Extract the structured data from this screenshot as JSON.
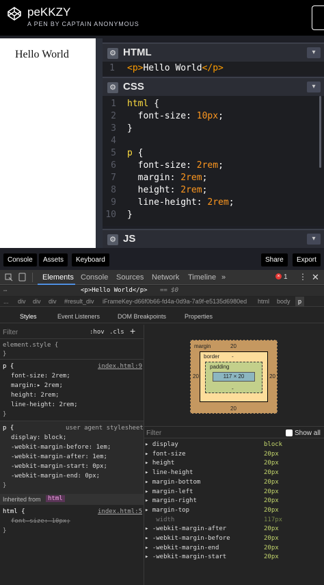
{
  "header": {
    "title": "peKKZY",
    "subtitle": "A PEN BY CAPTAIN ANONYMOUS"
  },
  "preview": {
    "text": "Hello World"
  },
  "html_panel": {
    "title": "HTML",
    "lines": [
      {
        "n": "1",
        "code": "<p>Hello World</p>"
      }
    ]
  },
  "css_panel": {
    "title": "CSS",
    "lines": [
      {
        "n": "1",
        "code": "html {"
      },
      {
        "n": "2",
        "code": "  font-size: 10px;"
      },
      {
        "n": "3",
        "code": "}"
      },
      {
        "n": "4",
        "code": ""
      },
      {
        "n": "5",
        "code": "p {"
      },
      {
        "n": "6",
        "code": "  font-size: 2rem;"
      },
      {
        "n": "7",
        "code": "  margin: 2rem;"
      },
      {
        "n": "8",
        "code": "  height: 2rem;"
      },
      {
        "n": "9",
        "code": "  line-height: 2rem;"
      },
      {
        "n": "10",
        "code": "}"
      }
    ]
  },
  "js_panel": {
    "title": "JS"
  },
  "bottom_bar": {
    "console": "Console",
    "assets": "Assets",
    "keyboard": "Keyboard",
    "share": "Share",
    "export": "Export"
  },
  "devtools": {
    "tabs": [
      "Elements",
      "Console",
      "Sources",
      "Network",
      "Timeline",
      "»"
    ],
    "error_count": "1",
    "selected_node": "<p>Hello World</p>",
    "selected_suffix": "== $0",
    "crumbs": [
      "...",
      "div",
      "div",
      "div",
      "#result_div",
      "iFrameKey-d66f0b66-fd4a-0d9a-7a9f-e5135d6980ed",
      "html",
      "body",
      "p"
    ],
    "subtabs": [
      "Styles",
      "Event Listeners",
      "DOM Breakpoints",
      "Properties"
    ],
    "filter_placeholder": "Filter",
    "hov": ":hov",
    "cls": ".cls",
    "element_style": "element.style {",
    "rule1_selector": "p {",
    "rule1_source": "index.html:9",
    "rule1_props": [
      "font-size: 2rem;",
      "margin:▸ 2rem;",
      "height: 2rem;",
      "line-height: 2rem;"
    ],
    "rule2_selector": "p {",
    "rule2_source": "user agent stylesheet",
    "rule2_props": [
      "display: block;",
      "-webkit-margin-before: 1em;",
      "-webkit-margin-after: 1em;",
      "-webkit-margin-start: 0px;",
      "-webkit-margin-end: 0px;"
    ],
    "inherited_label": "Inherited from",
    "inherited_tag": "html",
    "rule3_selector": "html {",
    "rule3_source": "index.html:5",
    "rule3_prop": "font-size: 10px;",
    "boxmodel": {
      "margin_label": "margin",
      "margin_top": "20",
      "margin_bottom": "20",
      "margin_left": "20",
      "margin_right": "20",
      "border_label": "border",
      "border_val": "-",
      "padding_label": "padding",
      "padding_val": "-",
      "content": "117 × 20",
      "dash": "-"
    },
    "computed_filter": "Filter",
    "show_all": "Show all",
    "computed": [
      {
        "k": "display",
        "v": "block"
      },
      {
        "k": "font-size",
        "v": "20px"
      },
      {
        "k": "height",
        "v": "20px"
      },
      {
        "k": "line-height",
        "v": "20px"
      },
      {
        "k": "margin-bottom",
        "v": "20px"
      },
      {
        "k": "margin-left",
        "v": "20px"
      },
      {
        "k": "margin-right",
        "v": "20px"
      },
      {
        "k": "margin-top",
        "v": "20px"
      },
      {
        "k": "width",
        "v": "117px"
      },
      {
        "k": "-webkit-margin-after",
        "v": "20px"
      },
      {
        "k": "-webkit-margin-before",
        "v": "20px"
      },
      {
        "k": "-webkit-margin-end",
        "v": "20px"
      },
      {
        "k": "-webkit-margin-start",
        "v": "20px"
      }
    ]
  }
}
